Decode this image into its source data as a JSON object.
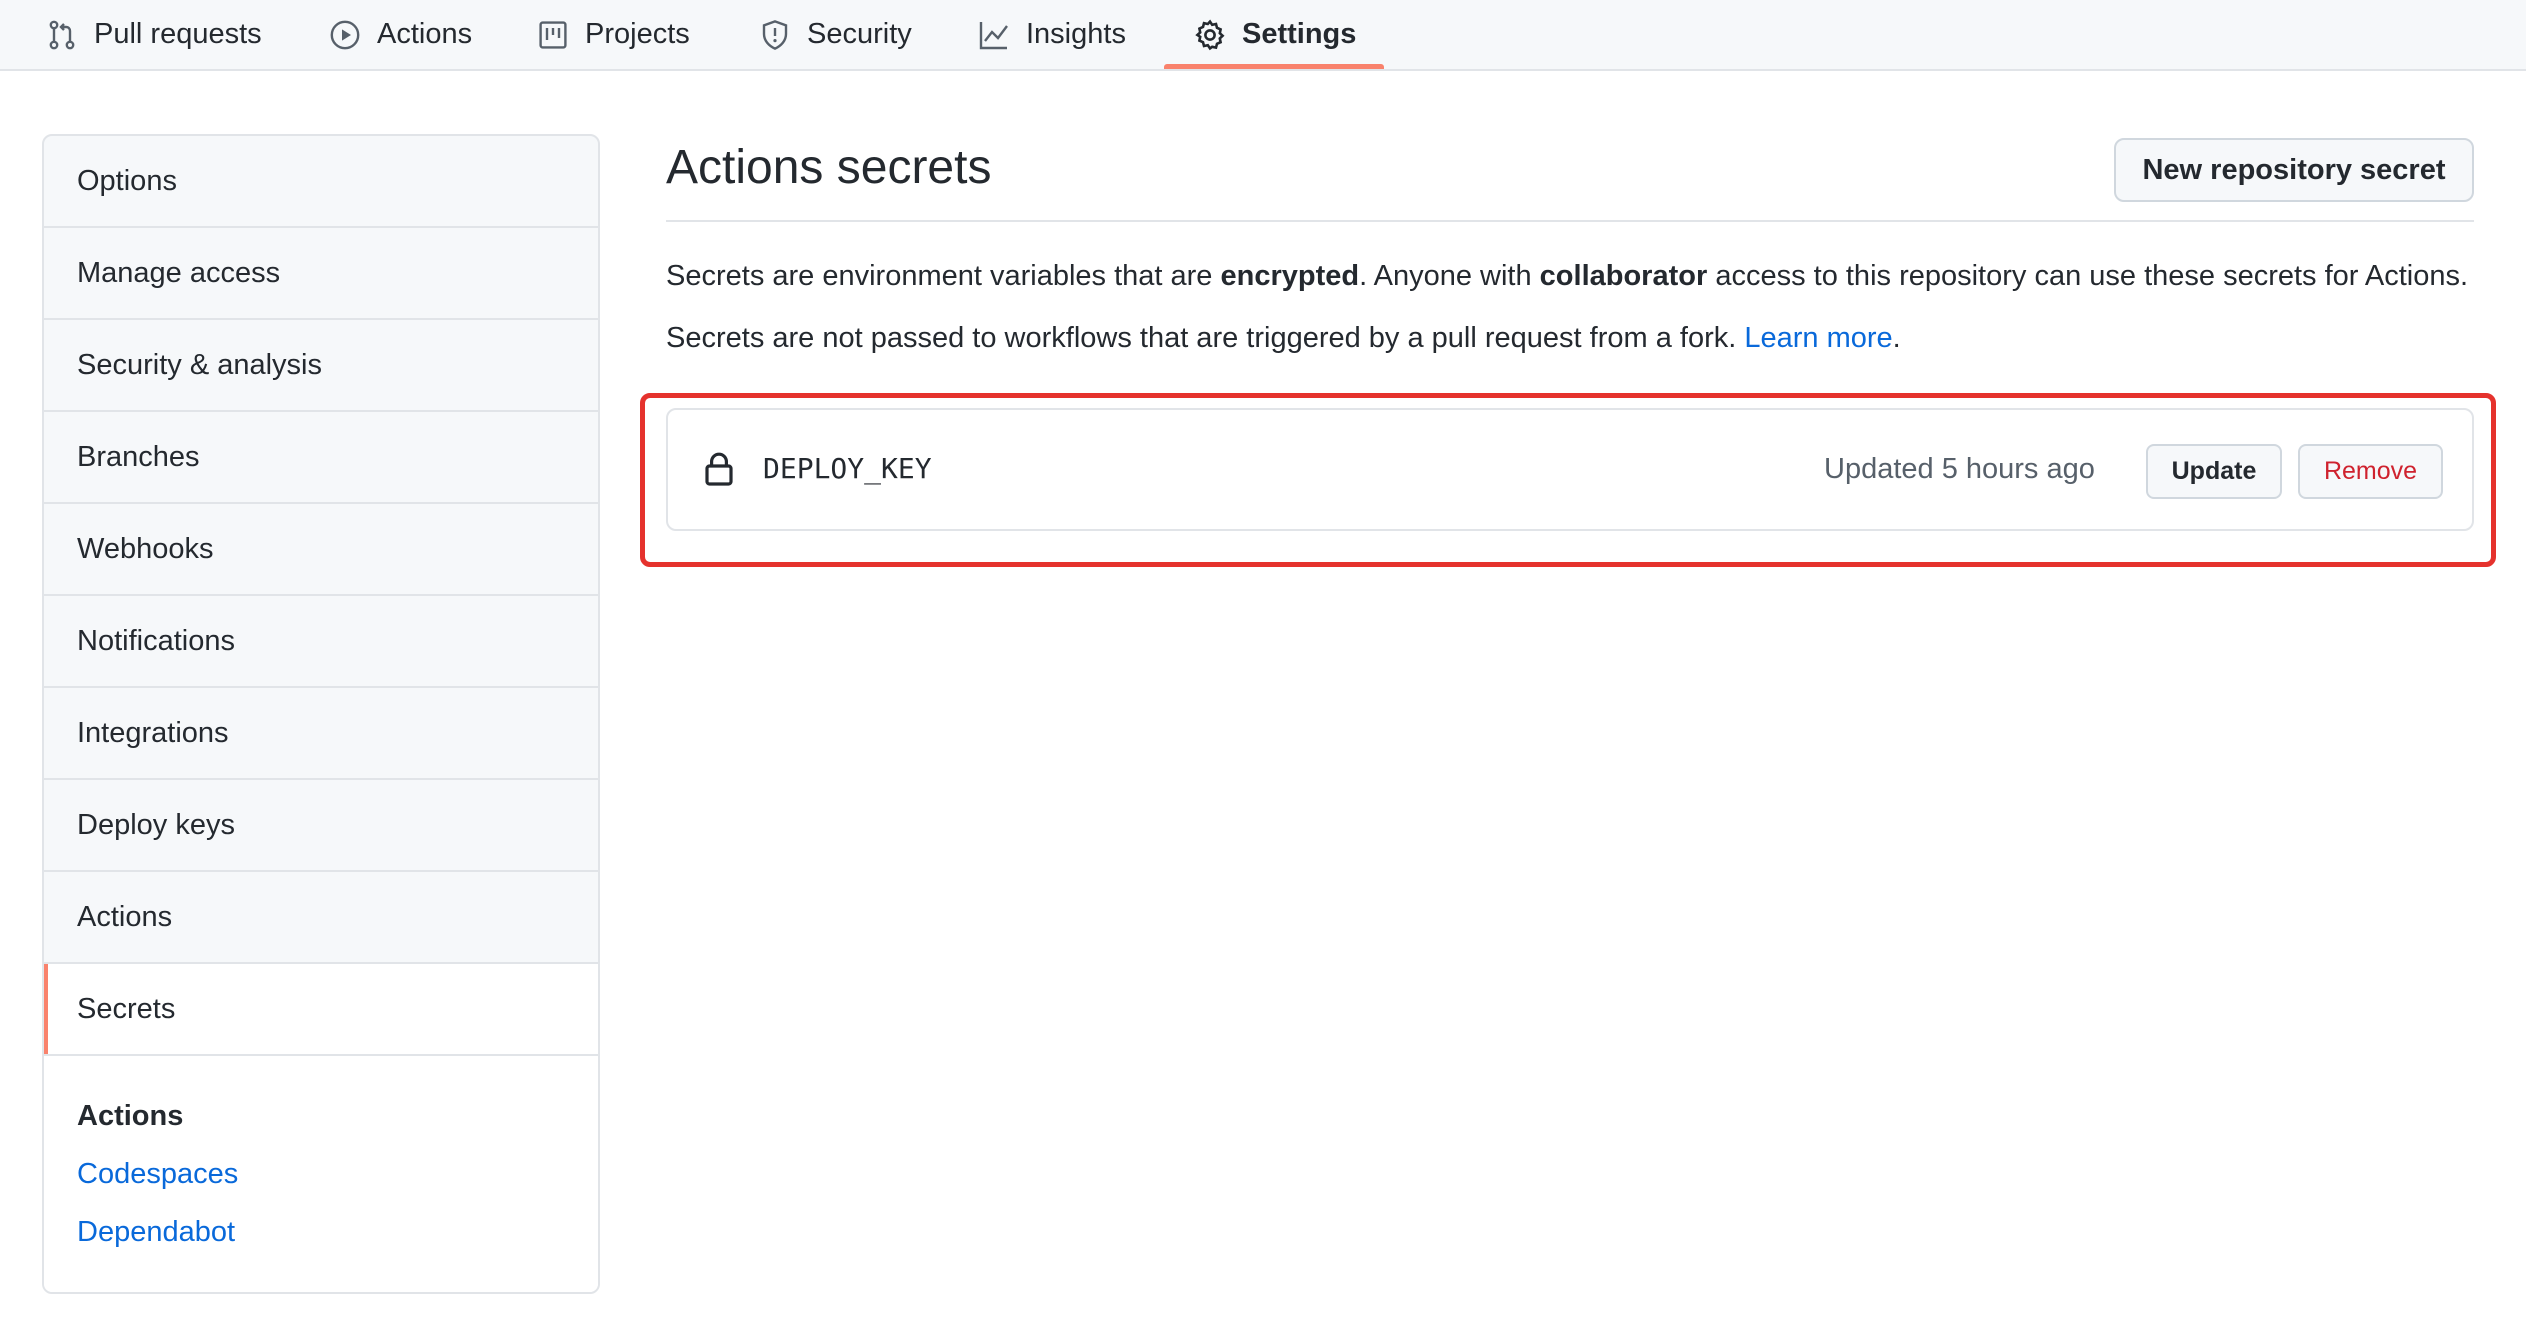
{
  "nav": {
    "tabs": [
      {
        "label": "Pull requests",
        "icon": "pull-request-icon"
      },
      {
        "label": "Actions",
        "icon": "play-icon"
      },
      {
        "label": "Projects",
        "icon": "project-icon"
      },
      {
        "label": "Security",
        "icon": "shield-icon"
      },
      {
        "label": "Insights",
        "icon": "graph-icon"
      },
      {
        "label": "Settings",
        "icon": "gear-icon",
        "selected": true
      }
    ]
  },
  "sidebar": {
    "items": [
      {
        "label": "Options"
      },
      {
        "label": "Manage access"
      },
      {
        "label": "Security & analysis"
      },
      {
        "label": "Branches"
      },
      {
        "label": "Webhooks"
      },
      {
        "label": "Notifications"
      },
      {
        "label": "Integrations"
      },
      {
        "label": "Deploy keys"
      },
      {
        "label": "Actions"
      },
      {
        "label": "Secrets",
        "active": true
      }
    ],
    "subsection": {
      "heading": "Actions",
      "links": [
        "Codespaces",
        "Dependabot"
      ]
    }
  },
  "main": {
    "title": "Actions secrets",
    "new_secret_button": "New repository secret",
    "description_1": {
      "part1": "Secrets are environment variables that are ",
      "bold1": "encrypted",
      "part2": ". Anyone with ",
      "bold2": "collaborator",
      "part3": " access to this repository can use these secrets for Actions."
    },
    "description_2": {
      "text": "Secrets are not passed to workflows that are triggered by a pull request from a fork. ",
      "link": "Learn more",
      "end": "."
    },
    "secrets": [
      {
        "name": "DEPLOY_KEY",
        "updated": "Updated 5 hours ago",
        "update_label": "Update",
        "remove_label": "Remove"
      }
    ]
  },
  "colors": {
    "accent_tab": "#f9826c",
    "link": "#0969da",
    "danger": "#cf222e",
    "highlight": "#e5322d"
  }
}
